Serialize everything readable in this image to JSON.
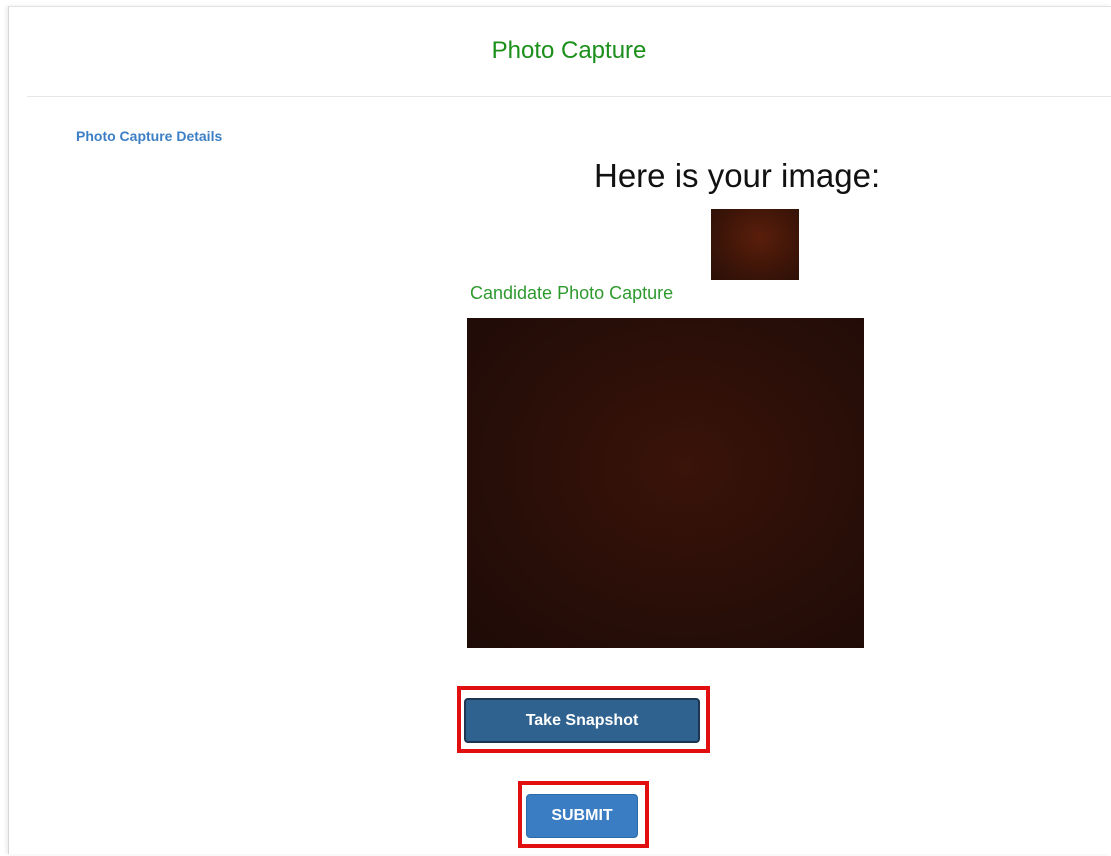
{
  "header": {
    "title": "Photo Capture"
  },
  "section": {
    "label": "Photo Capture Details"
  },
  "preview": {
    "heading": "Here is your image:"
  },
  "camera": {
    "label": "Candidate Photo Capture"
  },
  "actions": {
    "snapshot_label": "Take Snapshot",
    "submit_label": "SUBMIT"
  },
  "colors": {
    "title_green": "#1a8f1a",
    "label_blue": "#3d7fc4",
    "snapshot_button": "#30628f",
    "submit_button": "#3a7dc2",
    "highlight_red": "#e10f0f"
  }
}
